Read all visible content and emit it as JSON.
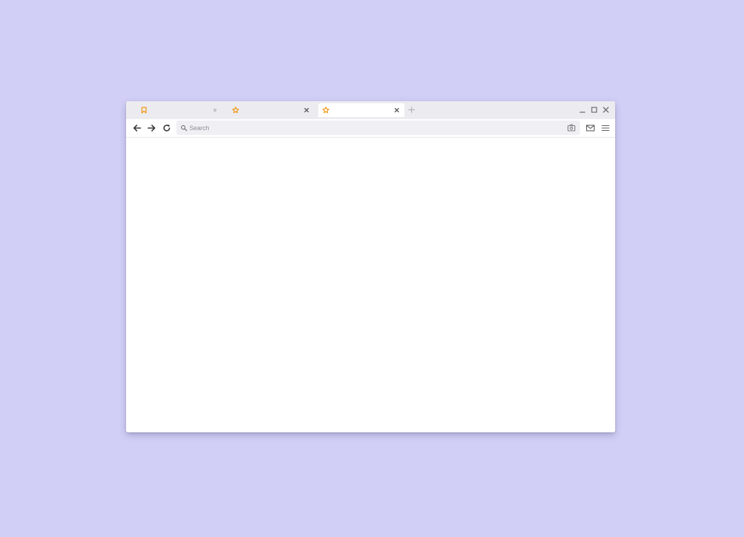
{
  "colors": {
    "background": "#d1cff5",
    "tab_bar": "#ecebf0",
    "favicon_accent": "#f0960f",
    "icon_gray": "#8c8c94",
    "icon_dark": "#333333"
  },
  "tabs": [
    {
      "title": "",
      "favicon": "bookmark-icon",
      "active": false
    },
    {
      "title": "",
      "favicon": "star-icon",
      "active": false
    },
    {
      "title": "",
      "favicon": "star-icon",
      "active": true
    }
  ],
  "toolbar": {
    "search_placeholder": "Search",
    "search_value": ""
  },
  "icons": {
    "nav": [
      "back-arrow-icon",
      "forward-arrow-icon",
      "reload-icon"
    ],
    "window": [
      "minimize-icon",
      "maximize-icon",
      "close-icon"
    ],
    "right": [
      "camera-icon",
      "mail-icon",
      "menu-icon"
    ]
  }
}
